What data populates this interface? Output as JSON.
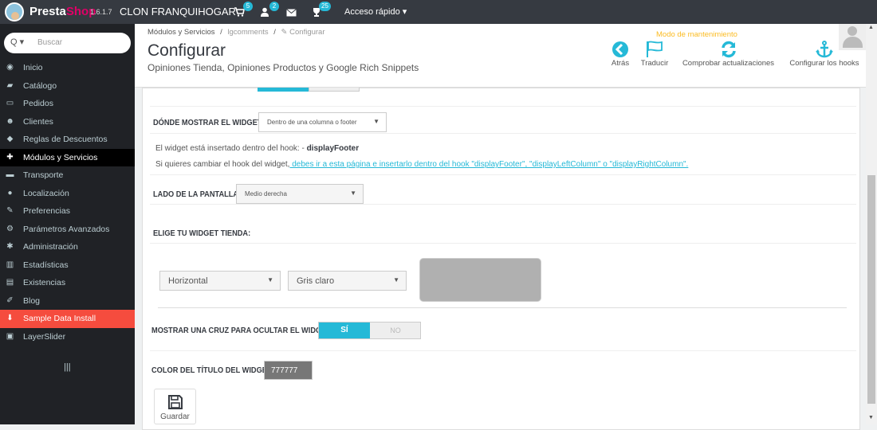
{
  "topbar": {
    "brand_a": "Presta",
    "brand_b": "Shop",
    "version": "1.6.1.7",
    "shop_name": "CLON FRANQUIHOGAR",
    "badges": {
      "cart": "5",
      "customers": "2",
      "messages_icon": "envelope-icon",
      "trophy": "25"
    },
    "quick_access": "Acceso rápido ▾"
  },
  "sidebar": {
    "search_placeholder": "Buscar",
    "search_icon": "Q ▾",
    "items": [
      {
        "label": "Inicio",
        "icon": "dashboard-icon",
        "glyph": "◉"
      },
      {
        "label": "Catálogo",
        "icon": "book-icon",
        "glyph": "▰"
      },
      {
        "label": "Pedidos",
        "icon": "credit-card-icon",
        "glyph": "▭"
      },
      {
        "label": "Clientes",
        "icon": "users-icon",
        "glyph": "☻"
      },
      {
        "label": "Reglas de Descuentos",
        "icon": "tag-icon",
        "glyph": "◆"
      },
      {
        "label": "Módulos y Servicios",
        "icon": "puzzle-icon",
        "glyph": "✚"
      },
      {
        "label": "Transporte",
        "icon": "truck-icon",
        "glyph": "▬"
      },
      {
        "label": "Localización",
        "icon": "globe-icon",
        "glyph": "●"
      },
      {
        "label": "Preferencias",
        "icon": "wrench-icon",
        "glyph": "✎"
      },
      {
        "label": "Parámetros Avanzados",
        "icon": "cogs-icon",
        "glyph": "⚙"
      },
      {
        "label": "Administración",
        "icon": "cog-icon",
        "glyph": "✱"
      },
      {
        "label": "Estadísticas",
        "icon": "bar-chart-icon",
        "glyph": "▥"
      },
      {
        "label": "Existencias",
        "icon": "archive-icon",
        "glyph": "▤"
      },
      {
        "label": "Blog",
        "icon": "edit-icon",
        "glyph": "✐"
      },
      {
        "label": "Sample Data Install",
        "icon": "download-icon",
        "glyph": "⬇"
      },
      {
        "label": "LayerSlider",
        "icon": "image-icon",
        "glyph": "▣"
      }
    ],
    "active_index": 5,
    "highlight_index": 14,
    "collapse_glyph": "|||"
  },
  "header": {
    "breadcrumb_1": "Módulos y Servicios",
    "breadcrumb_sep": "/",
    "breadcrumb_2": "lgcomments",
    "breadcrumb_3": "✎ Configurar",
    "title": "Configurar",
    "subtitle": "Opiniones Tienda, Opiniones Productos y Google Rich Snippets",
    "maintenance": "Modo de mantenimiento",
    "toolbar": {
      "back": "Atrás",
      "translate": "Traducir",
      "check_updates": "Comprobar actualizaciones",
      "configure_hooks": "Configurar los hooks"
    }
  },
  "form": {
    "where_label": "DÓNDE MOSTRAR EL WIDGET",
    "where_value": "Dentro de una columna o footer",
    "hook_info_prefix": "El widget está insertado dentro del hook: - ",
    "hook_info_hook": "displayFooter",
    "change_hook_prefix": "Si quieres cambiar el hook del widget,",
    "change_hook_link": " debes ir a esta página e insertarlo dentro del hook \"displayFooter\", \"displayLeftColumn\" o \"displayRightColumn\".",
    "side_label": "LADO DE LA PANTALLA",
    "side_value": "Medio derecha",
    "choose_label": "ELIGE TU WIDGET TIENDA:",
    "orientation_value": "Horizontal",
    "color_scheme_value": "Gris claro",
    "cross_label": "MOSTRAR UNA CRUZ PARA OCULTAR EL WIDGET",
    "cross_yes": "SÍ",
    "cross_no": "NO",
    "title_color_label": "COLOR DEL TÍTULO DEL WIDGET",
    "title_color_value": "777777",
    "save_label": "Guardar"
  },
  "colors": {
    "accent": "#25b9d7",
    "sidebar": "#202226",
    "topbar": "#363a41",
    "highlight": "#f54c3e",
    "maintenance": "#fbbb22"
  }
}
